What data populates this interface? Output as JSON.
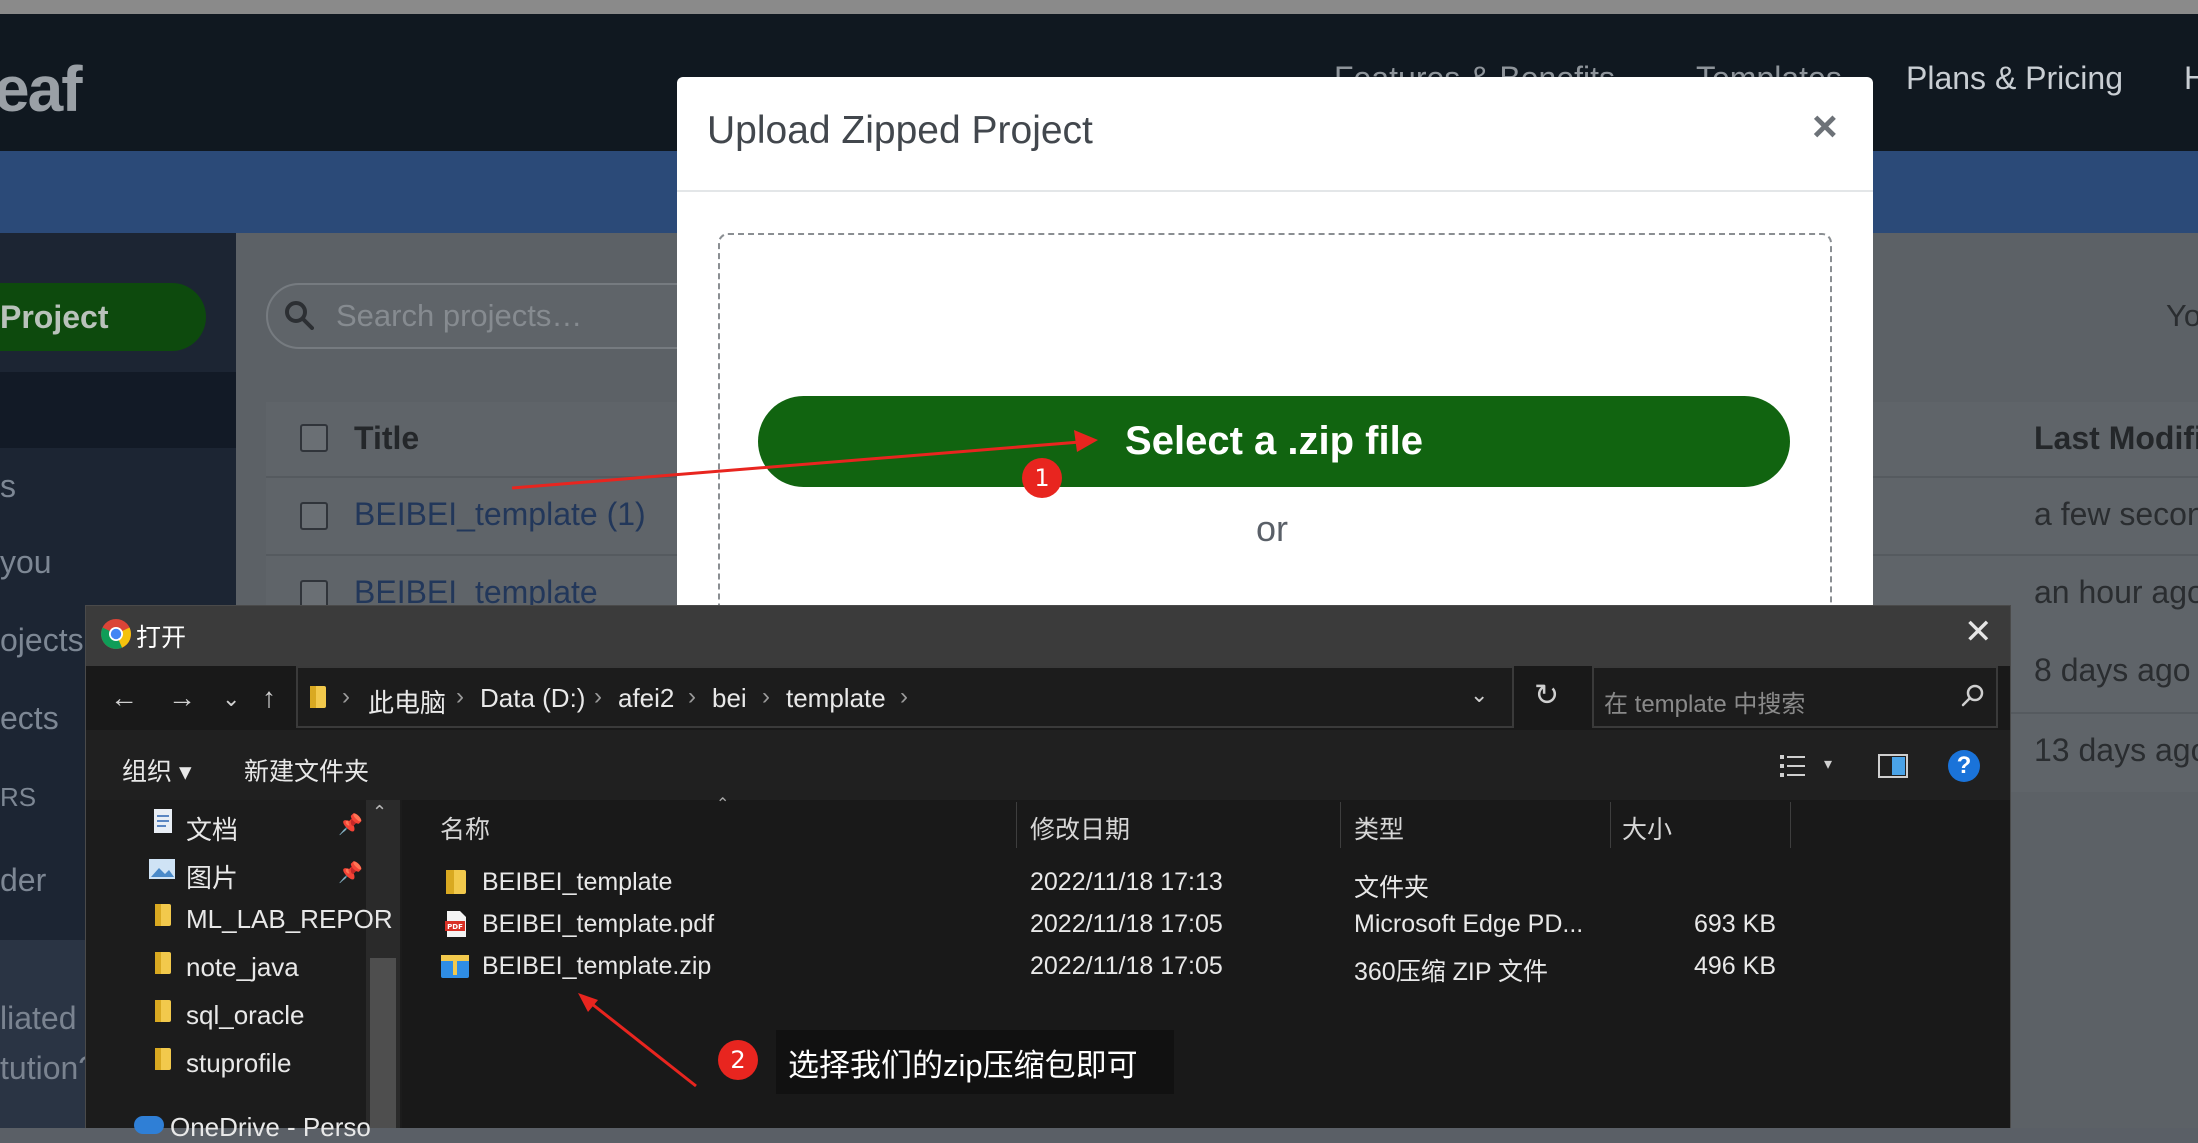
{
  "background": {
    "logo_fragment": "eaf",
    "nav_links": [
      "Features & Benefits",
      "Templates",
      "Plans & Pricing",
      "H"
    ],
    "sidebar": {
      "new_project_label": "Project",
      "items": [
        "s",
        "you",
        "ojects",
        "ects",
        "RS",
        "der",
        "liated",
        "tution?"
      ]
    },
    "search_placeholder": "Search projects…",
    "right_fragment": "Yo",
    "table": {
      "col_title": "Title",
      "col_modified": "Last Modifi",
      "rows": [
        {
          "title": "BEIBEI_template (1)",
          "modified": "a few secon"
        },
        {
          "title": "BEIBEI_template",
          "modified": "an hour ago"
        },
        {
          "title": "",
          "modified": "8 days ago b"
        },
        {
          "title": "",
          "modified": "13 days ago"
        }
      ]
    }
  },
  "modal": {
    "title": "Upload Zipped Project",
    "close_glyph": "×",
    "select_button": "Select a .zip file",
    "or_text": "or"
  },
  "file_dialog": {
    "title": "打开",
    "close_glyph": "✕",
    "nav": {
      "back": "←",
      "forward": "→",
      "recent": "⌄",
      "up": "↑"
    },
    "breadcrumb": [
      "此电脑",
      "Data (D:)",
      "afei2",
      "bei",
      "template"
    ],
    "refresh_glyph": "↻",
    "search_placeholder": "在 template 中搜索",
    "organize_label": "组织 ▾",
    "new_folder_label": "新建文件夹",
    "help_label": "?",
    "nav_pane": [
      {
        "label": "文档",
        "pinned": true
      },
      {
        "label": "图片",
        "pinned": true
      },
      {
        "label": "ML_LAB_REPOR",
        "pinned": false
      },
      {
        "label": "note_java",
        "pinned": false
      },
      {
        "label": "sql_oracle",
        "pinned": false
      },
      {
        "label": "stuprofile",
        "pinned": false
      }
    ],
    "onedrive_label": "OneDrive - Perso",
    "columns": {
      "name": "名称",
      "date": "修改日期",
      "type": "类型",
      "size": "大小"
    },
    "files": [
      {
        "name": "BEIBEI_template",
        "date": "2022/11/18 17:13",
        "type": "文件夹",
        "size": "",
        "icon": "folder-icon"
      },
      {
        "name": "BEIBEI_template.pdf",
        "date": "2022/11/18 17:05",
        "type": "Microsoft Edge PD...",
        "size": "693 KB",
        "icon": "pdf-file-icon"
      },
      {
        "name": "BEIBEI_template.zip",
        "date": "2022/11/18 17:05",
        "type": "360压缩 ZIP 文件",
        "size": "496 KB",
        "icon": "zip-file-icon"
      }
    ]
  },
  "annotations": {
    "step1": "1",
    "step2": "2",
    "step2_text": "选择我们的zip压缩包即可",
    "arrow_color": "#e8251f"
  }
}
